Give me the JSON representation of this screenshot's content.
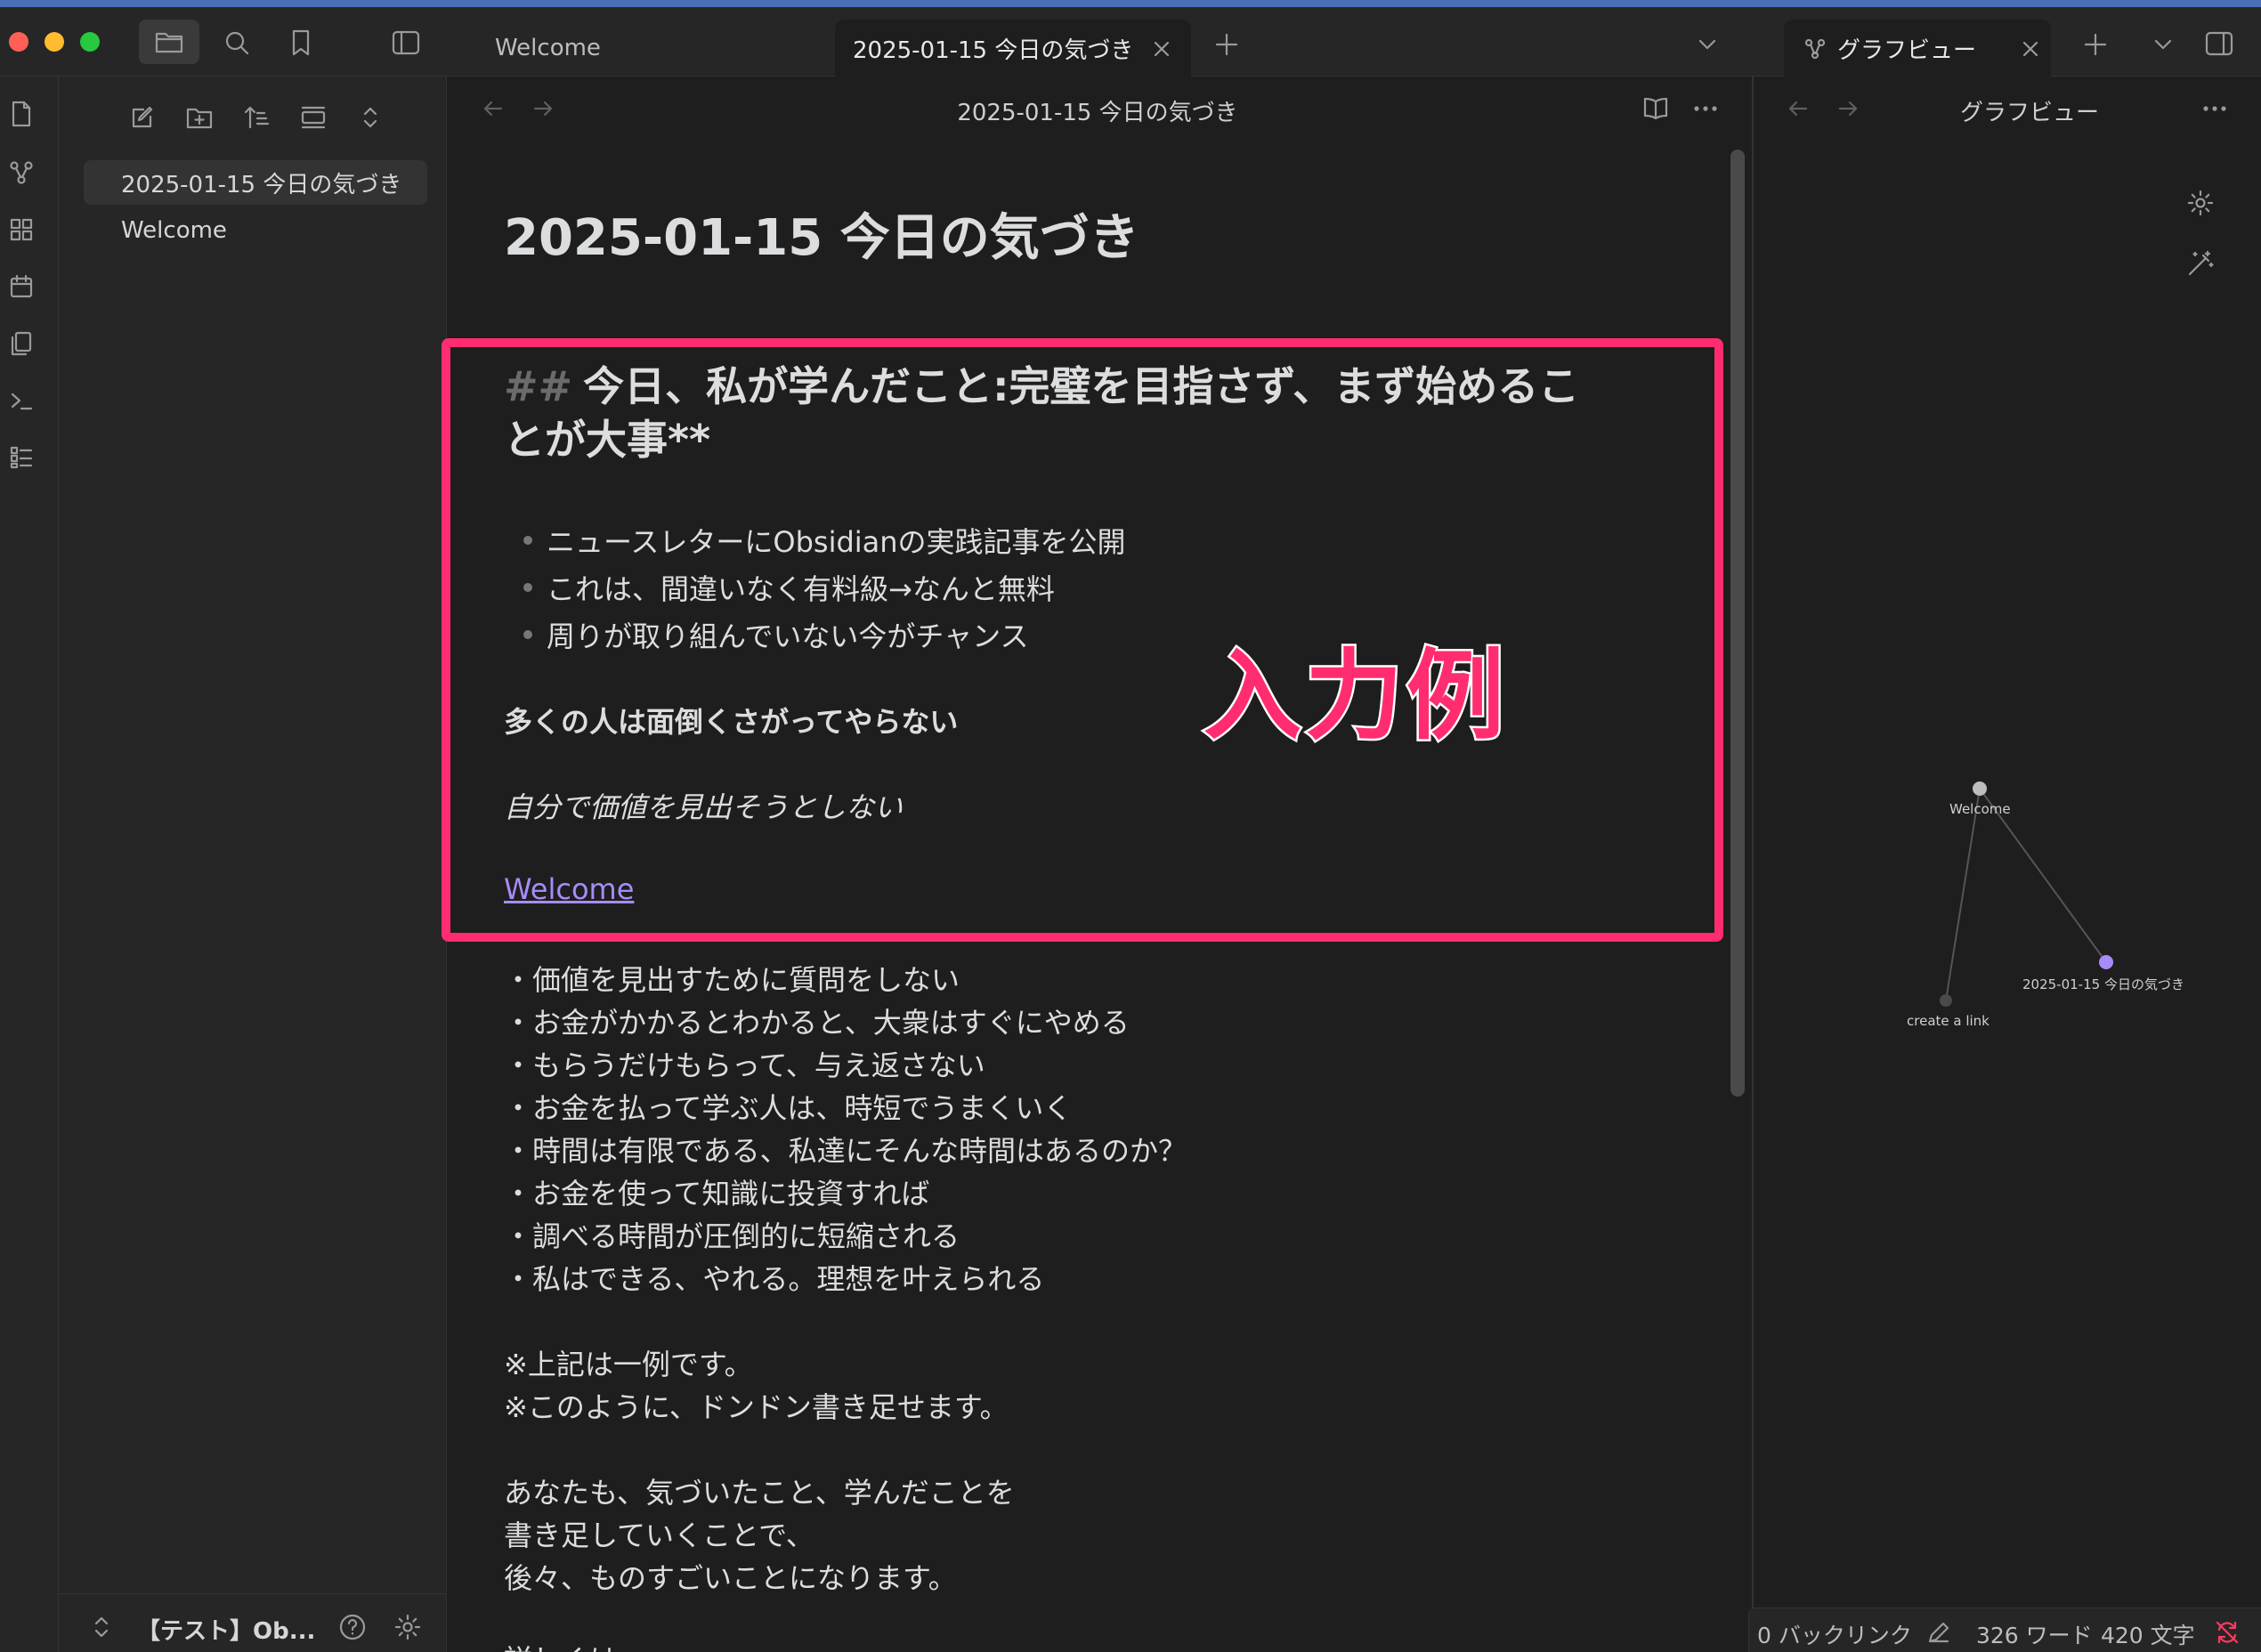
{
  "tabs": {
    "welcome": "Welcome",
    "active": "2025-01-15 今日の気づき",
    "graph": "グラフビュー"
  },
  "sidebar": {
    "files": [
      "2025-01-15 今日の気づき",
      "Welcome"
    ],
    "vault_name": "【テスト】Ob..."
  },
  "editor": {
    "header_title": "2025-01-15 今日の気づき",
    "doc_title": "2025-01-15 今日の気づき",
    "h2_marker": "##",
    "h2_line1": "今日、私が学んだこと:完璧を目指さず、まず始めるこ",
    "h2_line2": "とが大事**",
    "bullets": [
      "ニュースレターにObsidianの実践記事を公開",
      "これは、間違いなく有料級→なんと無料",
      "周りが取り組んでいない今がチャンス"
    ],
    "bold_line": "多くの人は面倒くさがってやらない",
    "italic_line": "自分で価値を見出そうとしない",
    "link_text": "Welcome",
    "list_lines": [
      "・価値を見出すために質問をしない",
      "・お金がかかるとわかると、大衆はすぐにやめる",
      "・もらうだけもらって、与え返さない",
      "・お金を払って学ぶ人は、時短でうまくいく",
      "・時間は有限である、私達にそんな時間はあるのか？",
      "・お金を使って知識に投資すれば",
      "・調べる時間が圧倒的に短縮される",
      "・私はできる、やれる。理想を叶えられる"
    ],
    "notes": [
      "※上記は一例です。",
      "※このように、ドンドン書き足せます。"
    ],
    "closing": [
      "あなたも、気づいたこと、学んだことを",
      "書き足していくことで、",
      "後々、ものすごいことになります。"
    ],
    "cut_line": "詳しくは"
  },
  "annotation": {
    "label": "入力例",
    "color": "#ff2d6f"
  },
  "graph": {
    "header_title": "グラフビュー",
    "nodes": {
      "welcome": "Welcome",
      "note": "2025-01-15 今日の気づき",
      "create": "create a link"
    }
  },
  "status": {
    "backlinks": "0 バックリンク",
    "words": "326 ワード",
    "chars": "420 文字"
  },
  "colors": {
    "accent": "#a88bfa",
    "link": "#a88bfa"
  },
  "icons": {
    "ribbon": [
      "open-note-icon",
      "graph-icon",
      "canvas-icon",
      "calendar-icon",
      "copy-icon",
      "terminal-icon",
      "outline-icon"
    ],
    "sidebar_toolbar": [
      "new-note-icon",
      "new-folder-icon",
      "sort-icon",
      "collapse-icon",
      "expand-icon"
    ]
  }
}
